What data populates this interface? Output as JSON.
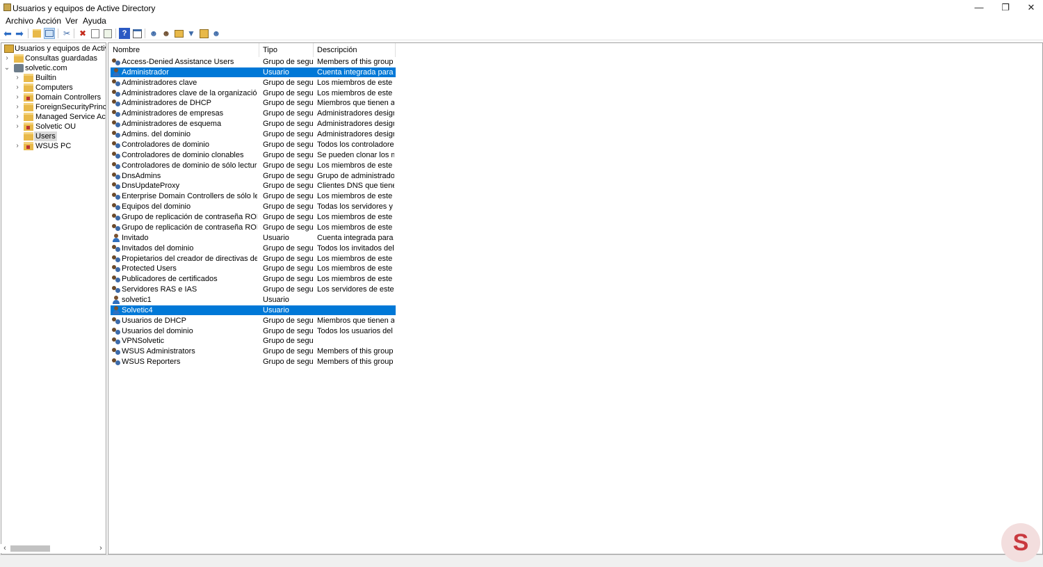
{
  "window": {
    "title": "Usuarios y equipos de Active Directory",
    "controls": {
      "minimize": "—",
      "restore": "❐",
      "close": "✕"
    }
  },
  "menu": [
    "Archivo",
    "Acción",
    "Ver",
    "Ayuda"
  ],
  "toolbar_icons": [
    "back-icon",
    "forward-icon",
    "up-folder-icon",
    "console-tree-icon",
    "cut-icon",
    "delete-icon",
    "properties-icon",
    "export-icon",
    "help-icon",
    "view-icon",
    "new-user-icon",
    "new-group-icon",
    "new-ou-icon",
    "filter-icon",
    "find-icon",
    "add-to-group-icon"
  ],
  "tree": {
    "root": "Usuarios y equipos de Active Directory",
    "saved_queries": "Consultas guardadas",
    "domain": "solvetic.com",
    "children": [
      "Builtin",
      "Computers",
      "Domain Controllers",
      "ForeignSecurityPrincipals",
      "Managed Service Accounts",
      "Solvetic OU",
      "Users",
      "WSUS PC"
    ],
    "selected": "Users"
  },
  "columns": {
    "name": "Nombre",
    "type": "Tipo",
    "description": "Descripción"
  },
  "rows": [
    {
      "name": "Access-Denied Assistance Users",
      "type": "Grupo de segu...",
      "desc": "Members of this group ...",
      "kind": "group"
    },
    {
      "name": "Administrador",
      "type": "Usuario",
      "desc": "Cuenta integrada para la...",
      "kind": "user",
      "selected": true
    },
    {
      "name": "Administradores clave",
      "type": "Grupo de segu...",
      "desc": "Los miembros de este gr...",
      "kind": "group"
    },
    {
      "name": "Administradores clave de la organización",
      "type": "Grupo de segu...",
      "desc": "Los miembros de este gr...",
      "kind": "group"
    },
    {
      "name": "Administradores de DHCP",
      "type": "Grupo de segu...",
      "desc": "Miembros que tienen ac...",
      "kind": "group"
    },
    {
      "name": "Administradores de empresas",
      "type": "Grupo de segu...",
      "desc": "Administradores design...",
      "kind": "group"
    },
    {
      "name": "Administradores de esquema",
      "type": "Grupo de segu...",
      "desc": "Administradores design...",
      "kind": "group"
    },
    {
      "name": "Admins. del dominio",
      "type": "Grupo de segu...",
      "desc": "Administradores design...",
      "kind": "group"
    },
    {
      "name": "Controladores de dominio",
      "type": "Grupo de segu...",
      "desc": "Todos los controladores ...",
      "kind": "group"
    },
    {
      "name": "Controladores de dominio clonables",
      "type": "Grupo de segu...",
      "desc": "Se pueden clonar los mi...",
      "kind": "group"
    },
    {
      "name": "Controladores de dominio de sólo lectura",
      "type": "Grupo de segu...",
      "desc": "Los miembros de este gr...",
      "kind": "group"
    },
    {
      "name": "DnsAdmins",
      "type": "Grupo de segu...",
      "desc": "Grupo de administrador...",
      "kind": "group"
    },
    {
      "name": "DnsUpdateProxy",
      "type": "Grupo de segu...",
      "desc": "Clientes DNS que tienen...",
      "kind": "group"
    },
    {
      "name": "Enterprise Domain Controllers de sólo lectura",
      "type": "Grupo de segu...",
      "desc": "Los miembros de este gr...",
      "kind": "group"
    },
    {
      "name": "Equipos del dominio",
      "type": "Grupo de segu...",
      "desc": "Todas los servidores y es...",
      "kind": "group"
    },
    {
      "name": "Grupo de replicación de contraseña RODC de...",
      "type": "Grupo de segu...",
      "desc": "Los miembros de este gr...",
      "kind": "group"
    },
    {
      "name": "Grupo de replicación de contraseña RODC per...",
      "type": "Grupo de segu...",
      "desc": "Los miembros de este gr...",
      "kind": "group"
    },
    {
      "name": "Invitado",
      "type": "Usuario",
      "desc": "Cuenta integrada para el...",
      "kind": "user"
    },
    {
      "name": "Invitados del dominio",
      "type": "Grupo de segu...",
      "desc": "Todos los invitados del d...",
      "kind": "group"
    },
    {
      "name": "Propietarios del creador de directivas de grupo",
      "type": "Grupo de segu...",
      "desc": "Los miembros de este gr...",
      "kind": "group"
    },
    {
      "name": "Protected Users",
      "type": "Grupo de segu...",
      "desc": "Los miembros de este gr...",
      "kind": "group"
    },
    {
      "name": "Publicadores de certificados",
      "type": "Grupo de segu...",
      "desc": "Los miembros de este gr...",
      "kind": "group"
    },
    {
      "name": "Servidores RAS e IAS",
      "type": "Grupo de segu...",
      "desc": "Los servidores de este gr...",
      "kind": "group"
    },
    {
      "name": "solvetic1",
      "type": "Usuario",
      "desc": "",
      "kind": "user"
    },
    {
      "name": "Solvetic4",
      "type": "Usuario",
      "desc": "",
      "kind": "user",
      "selected": true
    },
    {
      "name": "Usuarios de DHCP",
      "type": "Grupo de segu...",
      "desc": "Miembros que tienen ac...",
      "kind": "group"
    },
    {
      "name": "Usuarios del dominio",
      "type": "Grupo de segu...",
      "desc": "Todos los usuarios del d...",
      "kind": "group"
    },
    {
      "name": "VPNSolvetic",
      "type": "Grupo de segu...",
      "desc": "",
      "kind": "group"
    },
    {
      "name": "WSUS Administrators",
      "type": "Grupo de segu...",
      "desc": "Members of this group ...",
      "kind": "group"
    },
    {
      "name": "WSUS Reporters",
      "type": "Grupo de segu...",
      "desc": "Members of this group ...",
      "kind": "group"
    }
  ],
  "scroll_arrows": {
    "left": "‹",
    "right": "›"
  },
  "watermark": {
    "letter": "S"
  },
  "colors": {
    "selection": "#0078d7",
    "folder": "#e8b94a",
    "watermark": "#c9393f"
  }
}
